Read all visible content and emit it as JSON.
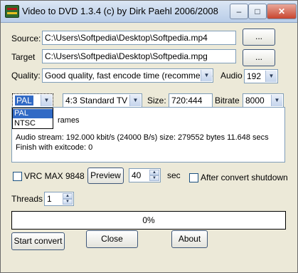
{
  "window": {
    "title": "Video to DVD 1.3.4 (c) by Dirk Paehl 2006/2008"
  },
  "source": {
    "label": "Source:",
    "value": "C:\\Users\\Softpedia\\Desktop\\Softpedia.mp4",
    "browse_label": "..."
  },
  "target": {
    "label": "Target",
    "value": "C:\\Users\\Softpedia\\Desktop\\Softpedia.mpg",
    "browse_label": "..."
  },
  "quality": {
    "label": "Quality:",
    "selected": "Good quality, fast encode time (recommend)"
  },
  "audio": {
    "label": "Audio",
    "selected": "192"
  },
  "format": {
    "tv_standard_selected": "PAL",
    "tv_standard_options": [
      "PAL",
      "NTSC"
    ],
    "aspect_selected": "4:3 Standard TV",
    "size_label": "Size:",
    "size_value": "720:444",
    "bitrate_label": "Bitrate",
    "bitrate_selected": "8000"
  },
  "log": {
    "line1": "rames",
    "line2": "Audio stream:  192.000 kbit/s  (24000 B/s)  size: 279552 bytes  11.648 secs",
    "line3": "Finish with exitcode: 0"
  },
  "options": {
    "vrc_label": "VRC MAX 9848",
    "preview_label": "Preview",
    "preview_seconds": "40",
    "sec_label": "sec",
    "shutdown_label": "After convert shutdown"
  },
  "threads": {
    "label": "Threads",
    "value": "1"
  },
  "progress": {
    "text": "0%"
  },
  "buttons": {
    "start": "Start convert",
    "close": "Close",
    "about": "About"
  }
}
